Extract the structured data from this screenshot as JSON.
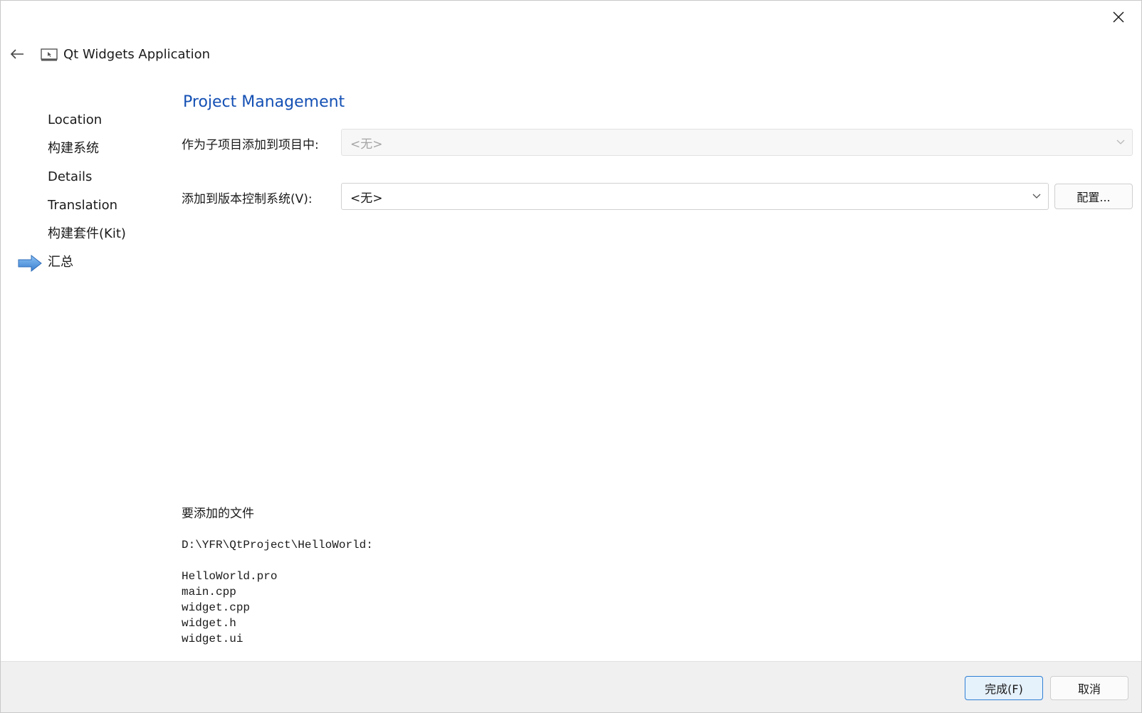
{
  "window": {
    "close_icon": "close-icon"
  },
  "header": {
    "back_icon": "arrow-left-icon",
    "app_icon": "qt-application-icon",
    "title": "Qt Widgets Application"
  },
  "sidebar": {
    "steps": [
      {
        "label": "Location"
      },
      {
        "label": "构建系统"
      },
      {
        "label": "Details"
      },
      {
        "label": "Translation"
      },
      {
        "label": "构建套件(Kit)"
      },
      {
        "label": "汇总",
        "current": true,
        "indicator_icon": "arrow-right-icon"
      }
    ]
  },
  "page": {
    "title": "Project Management",
    "subproject": {
      "label": "作为子项目添加到项目中:",
      "value": "<无>",
      "enabled": false
    },
    "vcs": {
      "label": "添加到版本控制系统(V):",
      "value": "<无>",
      "configure_label": "配置..."
    },
    "files": {
      "heading": "要添加的文件",
      "path": "D:\\YFR\\QtProject\\HelloWorld:",
      "list": [
        "HelloWorld.pro",
        "main.cpp",
        "widget.cpp",
        "widget.h",
        "widget.ui"
      ]
    }
  },
  "footer": {
    "finish_label": "完成(F)",
    "cancel_label": "取消"
  },
  "colors": {
    "section_title": "#1450b4",
    "indicator_arrow": "#4a90e2",
    "primary_button_border": "#2f7fd4",
    "primary_button_bg": "#e5f1fb"
  }
}
